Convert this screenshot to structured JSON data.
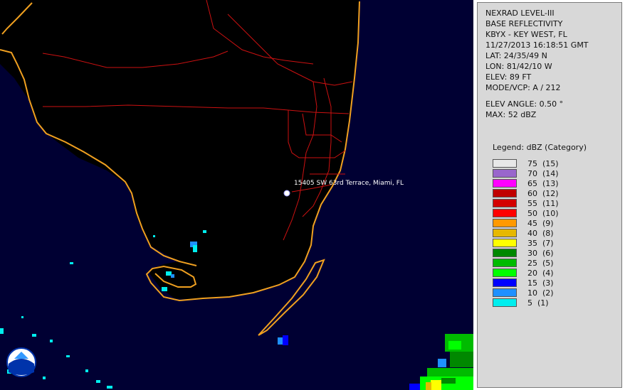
{
  "map": {
    "location_label": "15405 SW 63rd Terrace, Miami, FL",
    "colors": {
      "background": "#000033",
      "coast": "#f0a020",
      "roads": "#cc1111",
      "land": "#000000"
    }
  },
  "info": {
    "product": "NEXRAD LEVEL-III",
    "type": "BASE REFLECTIVITY",
    "station": "KBYX - KEY WEST, FL",
    "datetime": "11/27/2013 16:18:51 GMT",
    "lat": "LAT: 24/35/49 N",
    "lon": "LON: 81/42/10 W",
    "elev": "ELEV: 89 FT",
    "mode": "MODE/VCP: A / 212",
    "elev_angle": "ELEV ANGLE: 0.50 °",
    "max": "MAX: 52 dBZ"
  },
  "legend": {
    "title": "Legend: dBZ (Category)",
    "items": [
      {
        "label": "75  (15)",
        "color": "#e8e8e8"
      },
      {
        "label": "70  (14)",
        "color": "#9966cc"
      },
      {
        "label": "65  (13)",
        "color": "#ff00ff"
      },
      {
        "label": "60  (12)",
        "color": "#c00000"
      },
      {
        "label": "55  (11)",
        "color": "#d40000"
      },
      {
        "label": "50  (10)",
        "color": "#ff0000"
      },
      {
        "label": "45  (9)",
        "color": "#ff9900"
      },
      {
        "label": "40  (8)",
        "color": "#e6b800"
      },
      {
        "label": "35  (7)",
        "color": "#ffff00"
      },
      {
        "label": "30  (6)",
        "color": "#008800"
      },
      {
        "label": "25  (5)",
        "color": "#00bb00"
      },
      {
        "label": "20  (4)",
        "color": "#00ff00"
      },
      {
        "label": "15  (3)",
        "color": "#0000ff"
      },
      {
        "label": "10  (2)",
        "color": "#1e90ff"
      },
      {
        "label": "5  (1)",
        "color": "#00eeee"
      }
    ]
  }
}
